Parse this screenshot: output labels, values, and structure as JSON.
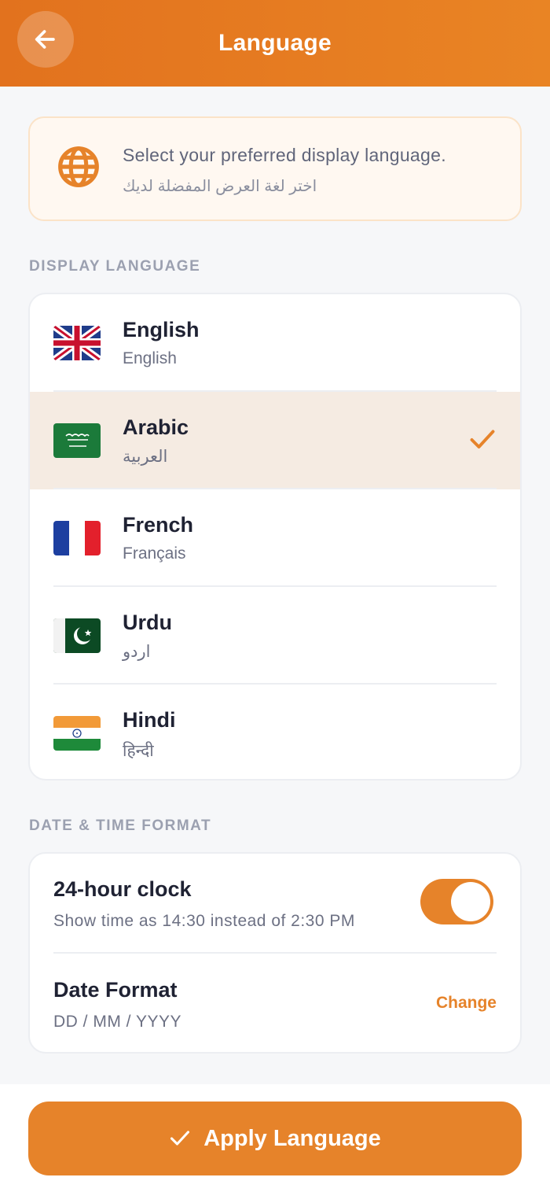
{
  "header": {
    "title": "Language",
    "back_icon": "arrow-left-icon"
  },
  "info": {
    "icon": "globe-icon",
    "text_en": "Select your preferred display language.",
    "text_ar": "اختر لغة العرض المفضلة لديك"
  },
  "sections": {
    "display_language": "DISPLAY LANGUAGE",
    "date_time_format": "DATE & TIME FORMAT"
  },
  "languages": [
    {
      "name": "English",
      "native": "English",
      "flag": "uk-flag-icon",
      "selected": false
    },
    {
      "name": "Arabic",
      "native": "العربية",
      "flag": "saudi-flag-icon",
      "selected": true
    },
    {
      "name": "French",
      "native": "Français",
      "flag": "france-flag-icon",
      "selected": false
    },
    {
      "name": "Urdu",
      "native": "اردو",
      "flag": "pakistan-flag-icon",
      "selected": false
    },
    {
      "name": "Hindi",
      "native": "हिन्दी",
      "flag": "india-flag-icon",
      "selected": false
    }
  ],
  "datetime": {
    "clock_title": "24-hour clock",
    "clock_subtitle": "Show time as 14:30 instead of 2:30 PM",
    "clock_enabled": true,
    "date_title": "Date Format",
    "date_value": "DD / MM / YYYY",
    "change_label": "Change"
  },
  "footer": {
    "apply_label": "Apply Language",
    "apply_icon": "check-icon"
  },
  "colors": {
    "accent": "#e6832a",
    "selected_row": "#f5ebe2",
    "info_bg": "#fff8f1"
  }
}
